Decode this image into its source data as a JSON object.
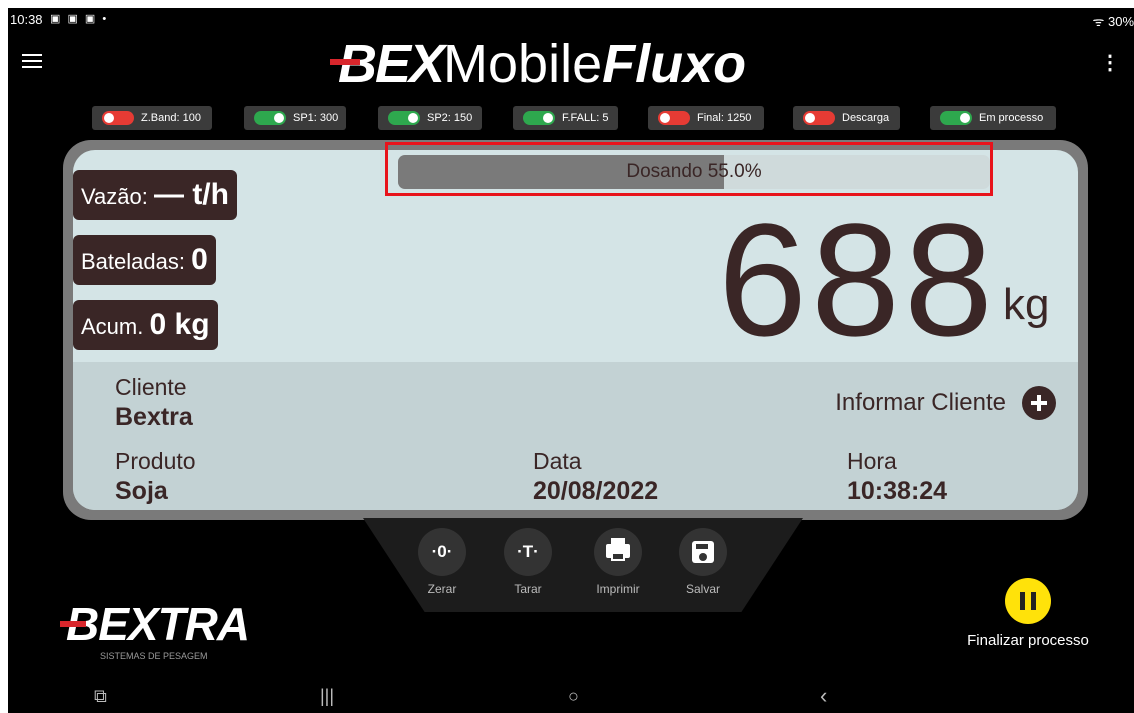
{
  "status_bar": {
    "time": "10:38",
    "notification_icons": "▣ ▣ ▣ •",
    "right": "ᯤ 30%"
  },
  "header": {
    "logo_bex": "BEX",
    "logo_mobile": "Mobile",
    "logo_fluxo": "Fluxo",
    "menu_icon": "hamburger-menu-icon",
    "more_icon": "more-vert-icon"
  },
  "chips": [
    {
      "label": "Z.Band: 100",
      "state": "off"
    },
    {
      "label": "SP1: 300",
      "state": "on"
    },
    {
      "label": "SP2: 150",
      "state": "on"
    },
    {
      "label": "F.FALL: 5",
      "state": "on"
    },
    {
      "label": "Final: 1250",
      "state": "off"
    },
    {
      "label": "Descarga",
      "state": "off"
    },
    {
      "label": "Em processo",
      "state": "on"
    }
  ],
  "progress": {
    "label": "Dosando 55.0%",
    "fraction": 0.55
  },
  "stats": {
    "vazao_label": "Vazão:",
    "vazao_value": "— t/h",
    "bateladas_label": "Bateladas:",
    "bateladas_value": "0",
    "acum_label": "Acum.",
    "acum_value": "0 kg"
  },
  "weight": {
    "value": "688",
    "unit": "kg"
  },
  "cliente": {
    "label": "Cliente",
    "value": "Bextra",
    "action": "Informar Cliente"
  },
  "produto": {
    "label": "Produto",
    "value": "Soja"
  },
  "data": {
    "label": "Data",
    "value": "20/08/2022"
  },
  "hora": {
    "label": "Hora",
    "value": "10:38:24"
  },
  "actions": {
    "zerar_icon": "·0·",
    "zerar": "Zerar",
    "tarar_icon": "·T·",
    "tarar": "Tarar",
    "imprimir": "Imprimir",
    "salvar": "Salvar"
  },
  "brand": {
    "name": "BEXTRA",
    "sub": "SISTEMAS DE PESAGEM"
  },
  "finalize": {
    "label": "Finalizar processo"
  },
  "colors": {
    "accent": "#d8262c",
    "panel": "#d4e4e6",
    "dark": "#3a2626",
    "toggle_on": "#2ea84e",
    "toggle_off": "#e63b34",
    "pause": "#ffe20a"
  },
  "navbar": {
    "screenshot_icon": "⧉",
    "recents": "|||",
    "home": "○",
    "back": "‹"
  }
}
